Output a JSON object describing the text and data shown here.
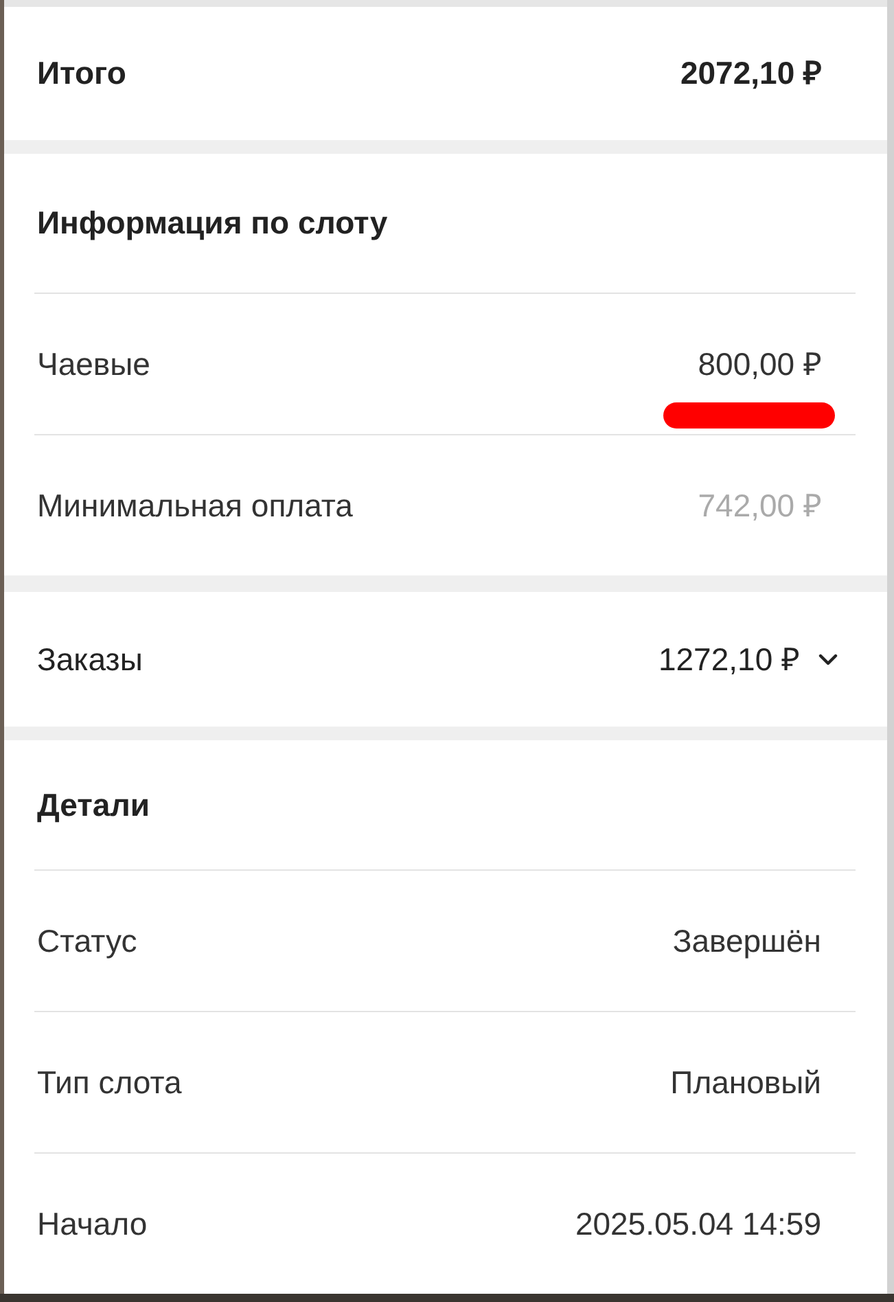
{
  "total": {
    "label": "Итого",
    "value": "2072,10 ₽"
  },
  "slot_info": {
    "title": "Информация по слоту",
    "rows": [
      {
        "label": "Чаевые",
        "value": "800,00 ₽",
        "muted": false,
        "marked": true
      },
      {
        "label": "Минимальная оплата",
        "value": "742,00 ₽",
        "muted": true,
        "marked": false
      }
    ]
  },
  "orders": {
    "label": "Заказы",
    "value": "1272,10 ₽",
    "expanded": false
  },
  "details": {
    "title": "Детали",
    "rows": [
      {
        "label": "Статус",
        "value": "Завершён"
      },
      {
        "label": "Тип слота",
        "value": "Плановый"
      },
      {
        "label": "Начало",
        "value": "2025.05.04 14:59"
      }
    ]
  }
}
